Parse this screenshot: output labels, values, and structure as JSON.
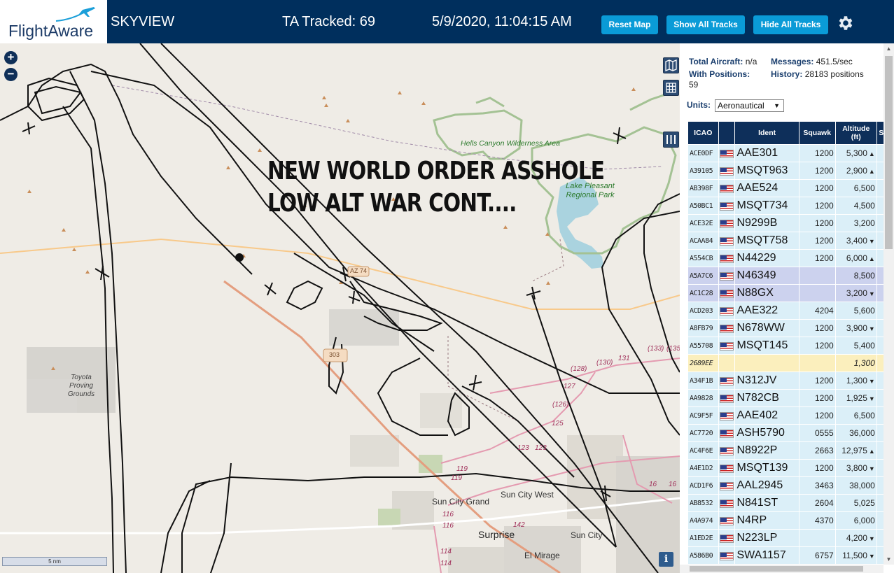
{
  "header": {
    "brand": "FlightAware",
    "title": "SKYVIEW",
    "tracked": "TA Tracked: 69",
    "datetime": "5/9/2020, 11:04:15 AM",
    "buttons": {
      "reset": "Reset Map",
      "show_tracks": "Show All Tracks",
      "hide_tracks": "Hide All Tracks"
    },
    "colors": {
      "bar": "#002f5d",
      "button": "#0a9bd7"
    }
  },
  "map": {
    "overlay_lines": [
      "NEW WORLD ORDER ASSHOLE",
      "LOW ALT WAR CONT...."
    ],
    "labels": {
      "hells_canyon": "Hells Canyon Wilderness Area",
      "lake_pleasant": "Lake Pleasant Regional Park",
      "toyota": "Toyota Proving Grounds",
      "sun_city_grand": "Sun City Grand",
      "sun_city_west": "Sun City West",
      "surprise": "Surprise",
      "sun_city": "Sun City",
      "el_mirage": "El Mirage",
      "az74": "AZ 74",
      "az303": "303"
    },
    "routes": [
      "(133)",
      "(135)",
      "131",
      "(130)",
      "(128)",
      "127",
      "(126)",
      "125",
      "123",
      "123",
      "119",
      "119",
      "116",
      "116",
      "114",
      "114",
      "142",
      "16",
      "16"
    ],
    "scale": "5 nm",
    "info_icon": "i",
    "zoom_in": "+",
    "zoom_out": "−"
  },
  "stats": {
    "total_aircraft_label": "Total Aircraft:",
    "total_aircraft_value": "n/a",
    "with_positions_label": "With Positions:",
    "with_positions_value": "59",
    "messages_label": "Messages:",
    "messages_value": "451.5/sec",
    "history_label": "History:",
    "history_value": "28183 positions",
    "units_label": "Units:",
    "units_value": "Aeronautical"
  },
  "table": {
    "columns": [
      "ICAO",
      "",
      "Ident",
      "Squawk",
      "Altitude (ft)",
      "Sp"
    ],
    "rows": [
      {
        "icao": "ACE0DF",
        "ident": "AAE301",
        "squawk": "1200",
        "alt": "5,300",
        "trend": "▲"
      },
      {
        "icao": "A39105",
        "ident": "MSQT963",
        "squawk": "1200",
        "alt": "2,900",
        "trend": "▲"
      },
      {
        "icao": "AB398F",
        "ident": "AAE524",
        "squawk": "1200",
        "alt": "6,500",
        "trend": ""
      },
      {
        "icao": "A50BC1",
        "ident": "MSQT734",
        "squawk": "1200",
        "alt": "4,500",
        "trend": ""
      },
      {
        "icao": "ACE32E",
        "ident": "N9299B",
        "squawk": "1200",
        "alt": "3,200",
        "trend": ""
      },
      {
        "icao": "ACAA84",
        "ident": "MSQT758",
        "squawk": "1200",
        "alt": "3,400",
        "trend": "▼"
      },
      {
        "icao": "A554CB",
        "ident": "N44229",
        "squawk": "1200",
        "alt": "6,000",
        "trend": "▲"
      },
      {
        "icao": "A5A7C6",
        "ident": "N46349",
        "squawk": "",
        "alt": "8,500",
        "trend": "",
        "sel": true
      },
      {
        "icao": "AC1C28",
        "ident": "N88GX",
        "squawk": "",
        "alt": "3,200",
        "trend": "▼",
        "sel": true
      },
      {
        "icao": "ACD203",
        "ident": "AAE322",
        "squawk": "4204",
        "alt": "5,600",
        "trend": ""
      },
      {
        "icao": "A8FB79",
        "ident": "N678WW",
        "squawk": "1200",
        "alt": "3,900",
        "trend": "▼"
      },
      {
        "icao": "A55708",
        "ident": "MSQT145",
        "squawk": "1200",
        "alt": "5,400",
        "trend": ""
      },
      {
        "icao": "2689EE",
        "ident": "",
        "squawk": "",
        "alt": "1,300",
        "trend": "",
        "yellow": true,
        "noflag": true
      },
      {
        "icao": "A34F1B",
        "ident": "N312JV",
        "squawk": "1200",
        "alt": "1,300",
        "trend": "▼"
      },
      {
        "icao": "AA9828",
        "ident": "N782CB",
        "squawk": "1200",
        "alt": "1,925",
        "trend": "▼"
      },
      {
        "icao": "AC9F5F",
        "ident": "AAE402",
        "squawk": "1200",
        "alt": "6,500",
        "trend": ""
      },
      {
        "icao": "AC7720",
        "ident": "ASH5790",
        "squawk": "0555",
        "alt": "36,000",
        "trend": ""
      },
      {
        "icao": "AC4F6E",
        "ident": "N8922P",
        "squawk": "2663",
        "alt": "12,975",
        "trend": "▲"
      },
      {
        "icao": "A4E1D2",
        "ident": "MSQT139",
        "squawk": "1200",
        "alt": "3,800",
        "trend": "▼"
      },
      {
        "icao": "ACD1F6",
        "ident": "AAL2945",
        "squawk": "3463",
        "alt": "38,000",
        "trend": ""
      },
      {
        "icao": "AB8532",
        "ident": "N841ST",
        "squawk": "2604",
        "alt": "5,025",
        "trend": ""
      },
      {
        "icao": "A4A974",
        "ident": "N4RP",
        "squawk": "4370",
        "alt": "6,000",
        "trend": ""
      },
      {
        "icao": "A1ED2E",
        "ident": "N223LP",
        "squawk": "",
        "alt": "4,200",
        "trend": "▼"
      },
      {
        "icao": "A586B0",
        "ident": "SWA1157",
        "squawk": "6757",
        "alt": "11,500",
        "trend": "▼"
      }
    ]
  }
}
